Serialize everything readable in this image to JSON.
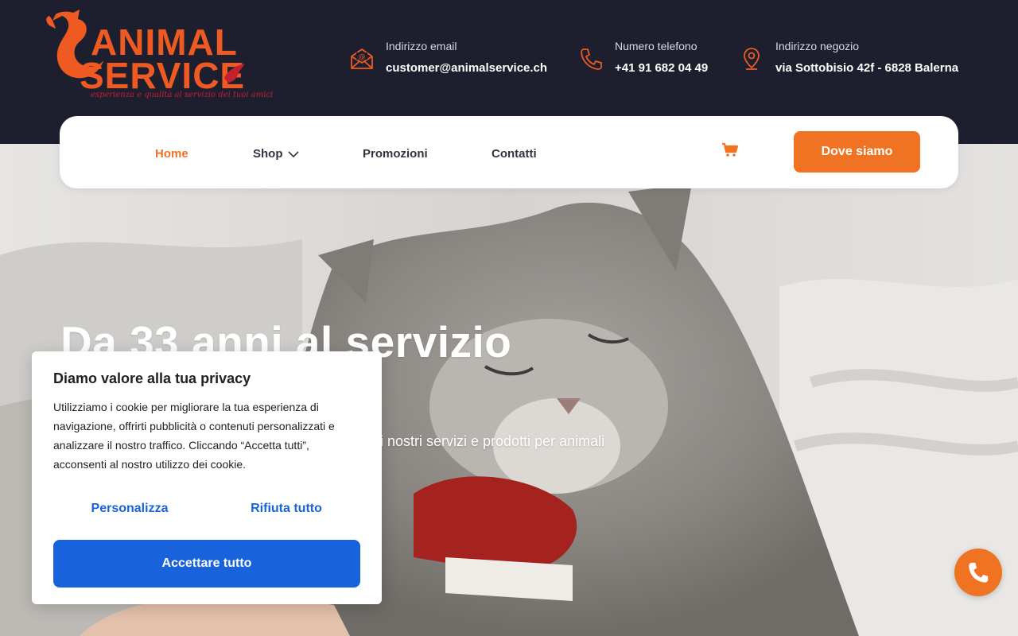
{
  "brand": {
    "logo_line1": "ANIMAL",
    "logo_line2": "SERVICE",
    "tagline": "esperienza e qualità al servizio dei tuoi amici",
    "logo_icon": "fox-silhouette-icon"
  },
  "contacts": [
    {
      "icon": "email-icon",
      "label": "Indirizzo email",
      "value": "customer@animalservice.ch"
    },
    {
      "icon": "phone-icon",
      "label": "Numero telefono",
      "value": "+41 91 682 04 49"
    },
    {
      "icon": "location-pin-icon",
      "label": "Indirizzo negozio",
      "value": "via Sottobisio 42f - 6828 Balerna"
    }
  ],
  "nav": {
    "items": [
      {
        "label": "Home",
        "active": true
      },
      {
        "label": "Shop",
        "has_dropdown": true
      },
      {
        "label": "Promozioni"
      },
      {
        "label": "Contatti"
      }
    ],
    "cart_icon": "shopping-cart-icon",
    "cta_label": "Dove siamo"
  },
  "hero": {
    "title": "Da 33 anni al servizio",
    "subtitle_visible": "i nostri servizi e prodotti per animali"
  },
  "cookie": {
    "title": "Diamo valore alla tua privacy",
    "text": "Utilizziamo i cookie per migliorare la tua esperienza di navigazione, offrirti pubblicità o contenuti personalizzati e analizzare il nostro traffico. Cliccando “Accetta tutti”, acconsenti al nostro utilizzo dei cookie.",
    "customize_label": "Personalizza",
    "reject_label": "Rifiuta tutto",
    "accept_label": "Accettare tutto"
  },
  "fab": {
    "icon": "phone-icon"
  },
  "colors": {
    "header_bg": "#1d1f2f",
    "accent_orange": "#f07324",
    "logo_orange": "#ef5a22",
    "logo_red": "#c51f2d",
    "cookie_blue": "#1863dc"
  }
}
